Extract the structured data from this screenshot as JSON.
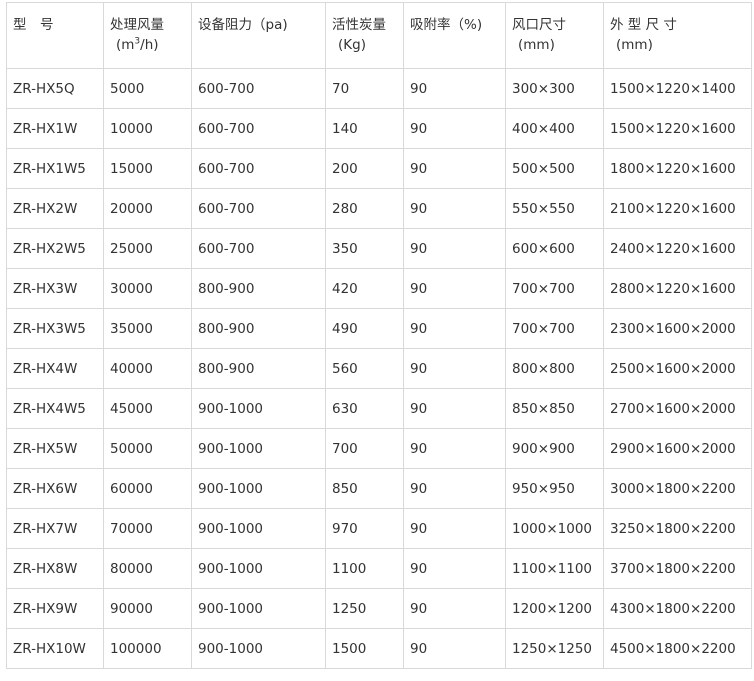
{
  "table": {
    "headers": [
      {
        "lines": [
          "型　号"
        ]
      },
      {
        "lines": [
          "处理风量",
          "(m³/h)"
        ],
        "parts": {
          "pre": "(m",
          "sup": "3",
          "post": "/h)"
        }
      },
      {
        "lines": [
          "设备阻力（pa)"
        ]
      },
      {
        "lines": [
          "活性炭量",
          "(Kg)"
        ]
      },
      {
        "lines": [
          "吸附率（%)"
        ]
      },
      {
        "lines": [
          "风口尺寸",
          "(mm)"
        ]
      },
      {
        "lines": [
          "外 型 尺 寸",
          "(mm)"
        ]
      }
    ],
    "rows": [
      [
        "ZR-HX5Q",
        "5000",
        "600-700",
        "70",
        "90",
        "300×300",
        "1500×1220×1400"
      ],
      [
        "ZR-HX1W",
        "10000",
        "600-700",
        "140",
        "90",
        "400×400",
        "1500×1220×1600"
      ],
      [
        "ZR-HX1W5",
        "15000",
        "600-700",
        "200",
        "90",
        "500×500",
        "1800×1220×1600"
      ],
      [
        "ZR-HX2W",
        "20000",
        "600-700",
        "280",
        "90",
        "550×550",
        "2100×1220×1600"
      ],
      [
        "ZR-HX2W5",
        "25000",
        "600-700",
        "350",
        "90",
        "600×600",
        "2400×1220×1600"
      ],
      [
        "ZR-HX3W",
        "30000",
        "800-900",
        "420",
        "90",
        "700×700",
        "2800×1220×1600"
      ],
      [
        "ZR-HX3W5",
        "35000",
        "800-900",
        "490",
        "90",
        "700×700",
        "2300×1600×2000"
      ],
      [
        "ZR-HX4W",
        "40000",
        "800-900",
        "560",
        "90",
        "800×800",
        "2500×1600×2000"
      ],
      [
        "ZR-HX4W5",
        "45000",
        "900-1000",
        "630",
        "90",
        "850×850",
        "2700×1600×2000"
      ],
      [
        "ZR-HX5W",
        "50000",
        "900-1000",
        "700",
        "90",
        "900×900",
        "2900×1600×2000"
      ],
      [
        "ZR-HX6W",
        "60000",
        "900-1000",
        "850",
        "90",
        "950×950",
        "3000×1800×2200"
      ],
      [
        "ZR-HX7W",
        "70000",
        "900-1000",
        "970",
        "90",
        "1000×1000",
        "3250×1800×2200"
      ],
      [
        "ZR-HX8W",
        "80000",
        "900-1000",
        "1100",
        "90",
        "1100×1100",
        "3700×1800×2200"
      ],
      [
        "ZR-HX9W",
        "90000",
        "900-1000",
        "1250",
        "90",
        "1200×1200",
        "4300×1800×2200"
      ],
      [
        "ZR-HX10W",
        "100000",
        "900-1000",
        "1500",
        "90",
        "1250×1250",
        "4500×1800×2200"
      ]
    ]
  }
}
